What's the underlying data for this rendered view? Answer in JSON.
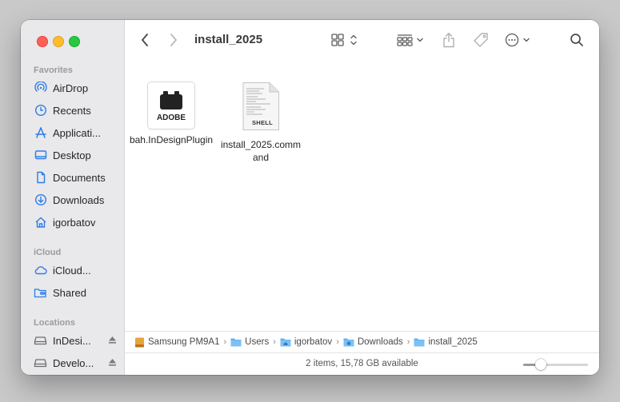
{
  "window": {
    "title": "install_2025"
  },
  "sidebar": {
    "favorites_label": "Favorites",
    "favorites": [
      {
        "label": "AirDrop",
        "icon": "airdrop-icon"
      },
      {
        "label": "Recents",
        "icon": "clock-icon"
      },
      {
        "label": "Applicati...",
        "icon": "applications-icon"
      },
      {
        "label": "Desktop",
        "icon": "desktop-icon"
      },
      {
        "label": "Documents",
        "icon": "document-icon"
      },
      {
        "label": "Downloads",
        "icon": "download-icon"
      },
      {
        "label": "igorbatov",
        "icon": "home-icon"
      }
    ],
    "icloud_label": "iCloud",
    "icloud": [
      {
        "label": "iCloud...",
        "icon": "cloud-icon"
      },
      {
        "label": "Shared",
        "icon": "shared-folder-icon"
      }
    ],
    "locations_label": "Locations",
    "locations": [
      {
        "label": "InDesi...",
        "icon": "disk-icon"
      },
      {
        "label": "Develo...",
        "icon": "disk-icon"
      }
    ]
  },
  "files": [
    {
      "name": "bah.InDesignPlugin",
      "icon_text": "ADOBE"
    },
    {
      "name": "install_2025.command",
      "icon_text": "SHELL"
    }
  ],
  "pathbar": [
    "Samsung PM9A1",
    "Users",
    "igorbatov",
    "Downloads",
    "install_2025"
  ],
  "status": {
    "text": "2 items, 15,78 GB available",
    "icon_size_fraction": 0.27
  },
  "colors": {
    "accent": "#2b7de9",
    "folder": "#5fb0f0",
    "disk": "#e8a33a"
  }
}
